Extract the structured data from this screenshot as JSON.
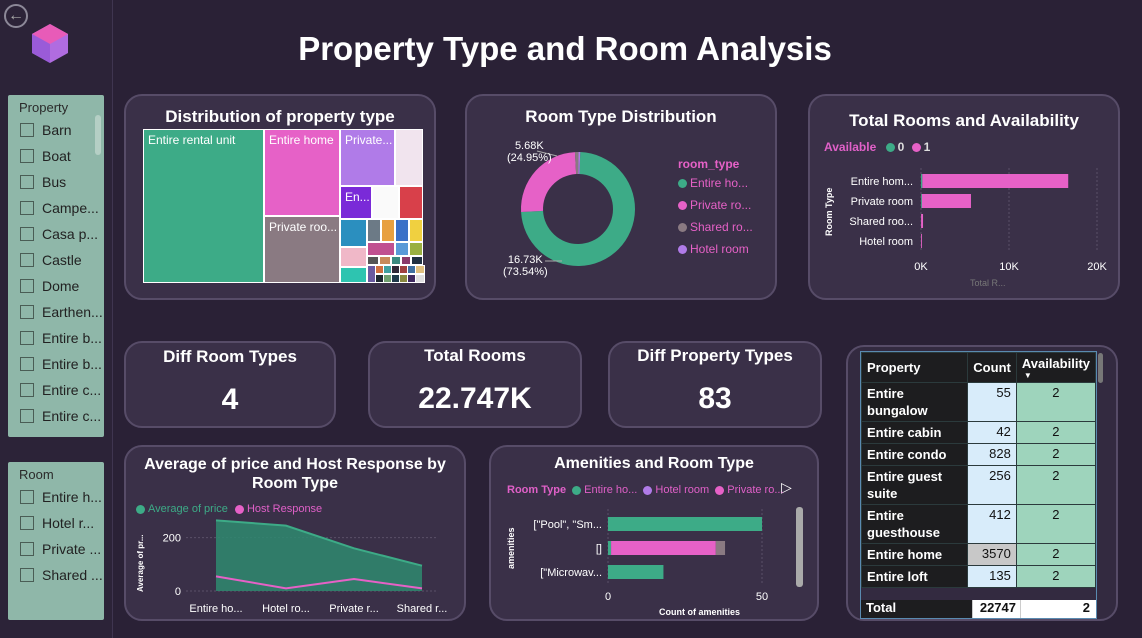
{
  "title": "Property Type and Room Analysis",
  "sidebar": {
    "property_slicer": {
      "title": "Property",
      "items": [
        "Barn",
        "Boat",
        "Bus",
        "Campe...",
        "Casa p...",
        "Castle",
        "Dome",
        "Earthen...",
        "Entire b...",
        "Entire b...",
        "Entire c...",
        "Entire c..."
      ]
    },
    "room_slicer": {
      "title": "Room",
      "items": [
        "Entire h...",
        "Hotel r...",
        "Private ...",
        "Shared ..."
      ]
    }
  },
  "treemap": {
    "title": "Distribution of property type",
    "labels": [
      "Entire rental unit",
      "Entire home",
      "Private...",
      "Private roo...",
      "En..."
    ]
  },
  "donut": {
    "title": "Room Type Distribution",
    "label_small": "5.68K",
    "label_small_pct": "(24.95%)",
    "label_large": "16.73K",
    "label_large_pct": "(73.54%)",
    "legend_title": "room_type",
    "legend": [
      "Entire ho...",
      "Private ro...",
      "Shared ro...",
      "Hotel room"
    ]
  },
  "availability": {
    "title": "Total Rooms and Availability",
    "legend_title": "Available",
    "legend_items": [
      "0",
      "1"
    ],
    "ylabel": "Room Type",
    "categories": [
      "Entire hom...",
      "Private room",
      "Shared roo...",
      "Hotel room"
    ],
    "ticks": [
      "0K",
      "10K",
      "20K"
    ],
    "xlabel": "Total R..."
  },
  "kpis": [
    {
      "label": "Diff Room Types",
      "value": "4"
    },
    {
      "label": "Total Rooms",
      "value": "22.747K"
    },
    {
      "label": "Diff Property Types",
      "value": "83"
    }
  ],
  "table": {
    "headers": [
      "Property",
      "Count",
      "Availability"
    ],
    "rows": [
      {
        "property": "Entire bungalow",
        "count": "55",
        "avail": "2"
      },
      {
        "property": "Entire cabin",
        "count": "42",
        "avail": "2"
      },
      {
        "property": "Entire condo",
        "count": "828",
        "avail": "2"
      },
      {
        "property": "Entire guest suite",
        "count": "256",
        "avail": "2"
      },
      {
        "property": "Entire guesthouse",
        "count": "412",
        "avail": "2"
      },
      {
        "property": "Entire home",
        "count": "3570",
        "avail": "2"
      },
      {
        "property": "Entire loft",
        "count": "135",
        "avail": "2"
      }
    ],
    "total_label": "Total",
    "total_count": "22747",
    "total_avail": "2"
  },
  "price_chart": {
    "title_line1": "Average of price and Host Response by",
    "title_line2": "Room Type",
    "legend": [
      "Average of price",
      "Host Response"
    ],
    "ylabel": "Average of pr...",
    "yticks": [
      "200",
      "0"
    ],
    "categories": [
      "Entire ho...",
      "Hotel ro...",
      "Private r...",
      "Shared r..."
    ]
  },
  "amenities": {
    "title": "Amenities and Room Type",
    "legend_title": "Room Type",
    "legend": [
      "Entire ho...",
      "Hotel room",
      "Private ro..."
    ],
    "ylabel": "amenities",
    "categories": [
      "[\"Pool\", \"Sm...",
      "[]",
      "[\"Microwav..."
    ],
    "xticks": [
      "0",
      "50"
    ],
    "xlabel": "Count of amenities"
  },
  "colors": {
    "green": "#3dab87",
    "pink": "#e661c7",
    "purple": "#b07be8",
    "grey": "#8a7a82",
    "background": "#2a2136"
  },
  "chart_data": [
    {
      "type": "pie",
      "title": "Room Type Distribution",
      "categories": [
        "Entire home/apt",
        "Private room",
        "Shared room",
        "Hotel room"
      ],
      "values": [
        16730,
        5680,
        230,
        110
      ]
    },
    {
      "type": "bar",
      "title": "Total Rooms and Availability",
      "categories": [
        "Entire hom...",
        "Private room",
        "Shared roo...",
        "Hotel room"
      ],
      "series": [
        {
          "name": "0",
          "values": [
            150,
            100,
            10,
            5
          ]
        },
        {
          "name": "1",
          "values": [
            16580,
            5580,
            220,
            100
          ]
        }
      ],
      "xlim": [
        0,
        20000
      ]
    },
    {
      "type": "area",
      "title": "Average of price and Host Response by Room Type",
      "categories": [
        "Entire ho...",
        "Hotel ro...",
        "Private r...",
        "Shared r..."
      ],
      "series": [
        {
          "name": "Average of price",
          "values": [
            265,
            245,
            160,
            95
          ]
        },
        {
          "name": "Host Response",
          "values": [
            55,
            10,
            45,
            10
          ]
        }
      ]
    },
    {
      "type": "bar",
      "title": "Amenities and Room Type",
      "categories": [
        "[\"Pool\", \"Sm...",
        "[]",
        "[\"Microwav..."
      ],
      "series": [
        {
          "name": "Entire ho...",
          "values": [
            50,
            1,
            18
          ]
        },
        {
          "name": "Hotel room",
          "values": [
            0,
            0,
            0
          ]
        },
        {
          "name": "Private ro...",
          "values": [
            0,
            34,
            0
          ]
        }
      ],
      "xlim": [
        0,
        55
      ]
    }
  ]
}
